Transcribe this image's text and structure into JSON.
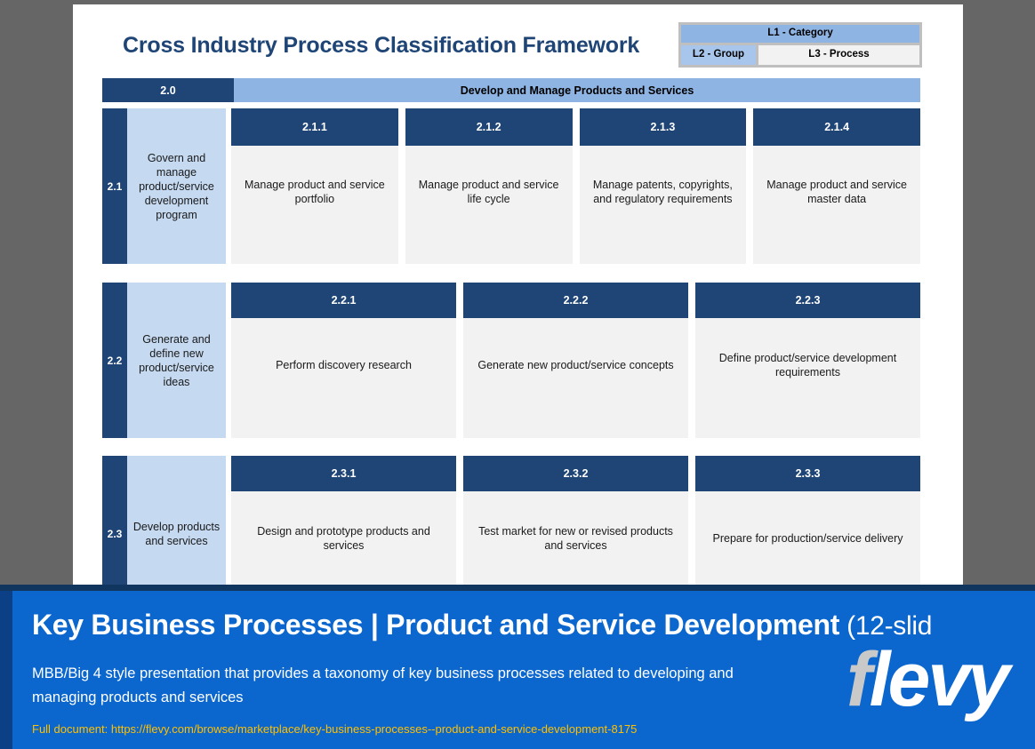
{
  "slide": {
    "title": "Cross Industry Process Classification Framework",
    "legend": {
      "l1": "L1 - Category",
      "l2": "L2 - Group",
      "l3": "L3 - Process"
    },
    "category": {
      "number": "2.0",
      "name": "Develop and Manage Products and Services"
    },
    "groups": [
      {
        "number": "2.1",
        "name": "Govern and manage product/service development program",
        "processes": [
          {
            "number": "2.1.1",
            "name": "Manage product and service portfolio"
          },
          {
            "number": "2.1.2",
            "name": "Manage product and service life cycle"
          },
          {
            "number": "2.1.3",
            "name": "Manage patents, copyrights, and regulatory requirements"
          },
          {
            "number": "2.1.4",
            "name": "Manage product and service master data"
          }
        ]
      },
      {
        "number": "2.2",
        "name": "Generate and define new product/service ideas",
        "processes": [
          {
            "number": "2.2.1",
            "name": "Perform discovery research"
          },
          {
            "number": "2.2.2",
            "name": "Generate new product/service concepts"
          },
          {
            "number": "2.2.3",
            "name": "Define product/service development requirements"
          }
        ]
      },
      {
        "number": "2.3",
        "name": "Develop products and services",
        "processes": [
          {
            "number": "2.3.1",
            "name": "Design and prototype products and services"
          },
          {
            "number": "2.3.2",
            "name": "Test market for new or revised products and services"
          },
          {
            "number": "2.3.3",
            "name": "Prepare for production/service delivery"
          }
        ]
      }
    ]
  },
  "banner": {
    "title_main": "Key Business Processes | Product and Service Development",
    "title_suffix": " (12-slid",
    "subtitle": "MBB/Big 4 style presentation that provides a taxonomy of key business processes related to developing and managing products and services",
    "url_label": "Full document: https://flevy.com/browse/marketplace/key-business-processes--product-and-service-development-8175",
    "logo_f": "f",
    "logo_levy": "levy"
  },
  "colors": {
    "navy": "#1F4576",
    "light_blue": "#8EB4E3",
    "pale_blue": "#C5D9F1",
    "process_bg": "#F2F2F2",
    "banner_blue": "#0B66CE",
    "banner_url": "#FFC000",
    "backdrop": "#666666"
  }
}
